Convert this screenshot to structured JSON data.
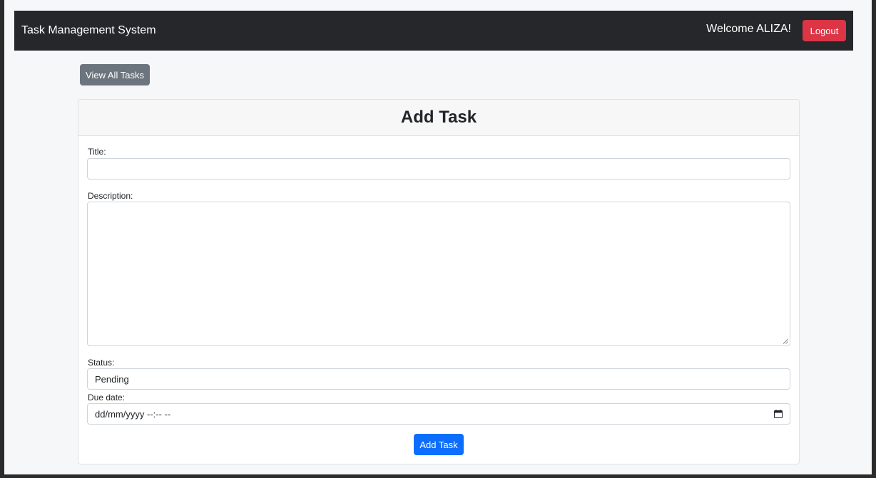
{
  "navbar": {
    "brand": "Task Management System",
    "welcome": "Welcome ALIZA!",
    "logout_label": "Logout"
  },
  "actions": {
    "view_all_label": "View All Tasks"
  },
  "form": {
    "title": "Add Task",
    "fields": {
      "title_label": "Title:",
      "title_value": "",
      "description_label": "Description:",
      "description_value": "",
      "status_label": "Status:",
      "status_value": "Pending",
      "due_date_label": "Due date:",
      "due_date_placeholder": "dd/mm/yyyy --:-- --"
    },
    "submit_label": "Add Task"
  },
  "icons": {
    "calendar": "calendar-icon",
    "resize": "resize-grip-icon"
  },
  "colors": {
    "navbar_bg": "#26272b",
    "logout": "#dc3545",
    "secondary": "#6c757d",
    "primary": "#0d6efd"
  }
}
